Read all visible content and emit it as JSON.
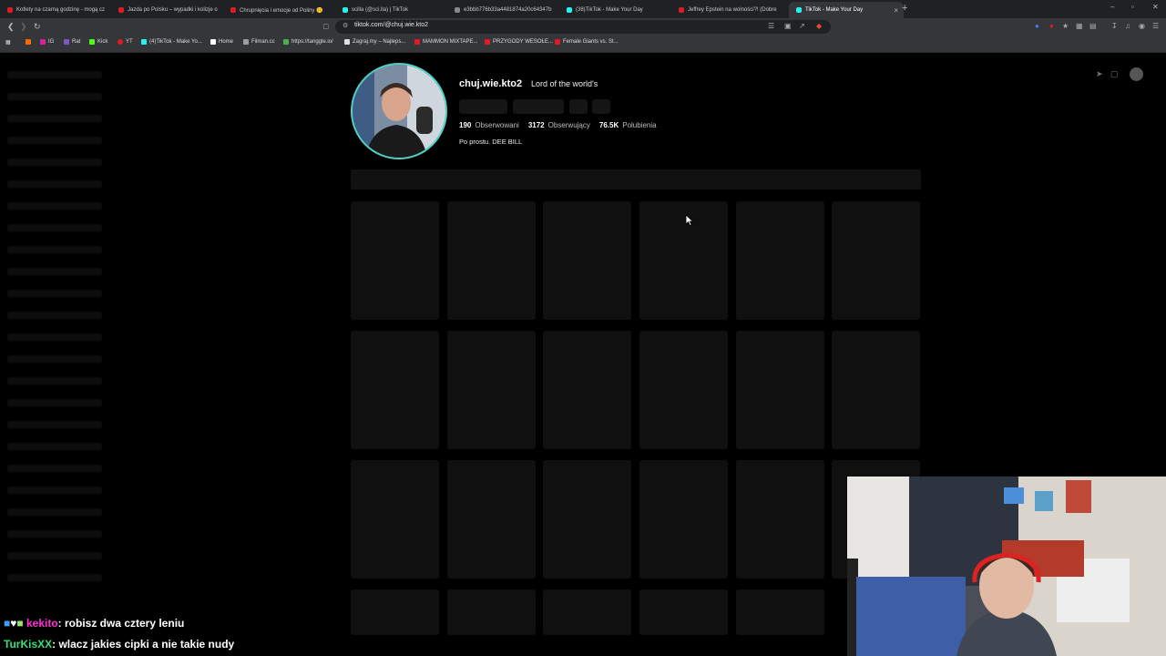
{
  "browser": {
    "tabs": [
      {
        "title": "Kotlety na czarną godzinę - mogą cz",
        "fav_color": "#e01b24"
      },
      {
        "title": "Jazda po Polsku – wypadki i kolizje o",
        "fav_color": "#e01b24"
      },
      {
        "title": "Chrupnięcia i emocje od Poliny 🤫",
        "fav_color": "#e01b24"
      },
      {
        "title": "scilla (@sci.lla) | TikTok",
        "fav_color": "#25f4ee"
      },
      {
        "title": "e3bbb776b33a4481874a20c64347b",
        "fav_color": "#888888"
      },
      {
        "title": "(38)TikTok - Make Your Day",
        "fav_color": "#25f4ee"
      },
      {
        "title": "Jeffrey Epstein na wolności?! (Dobre",
        "fav_color": "#e01b24"
      },
      {
        "title": "TikTok - Make Your Day",
        "fav_color": "#25f4ee",
        "active": true
      }
    ],
    "new_tab": "+",
    "close_tab": "×",
    "window_controls": [
      "–",
      "▫",
      "✕"
    ],
    "url": "tiktok.com/@chuj.wie.kto2",
    "bookmarks": [
      {
        "label": "",
        "color": "#ff6a00"
      },
      {
        "label": "IG",
        "color": "#d6249f"
      },
      {
        "label": "Rat",
        "color": "#7e57c2"
      },
      {
        "label": "Kick",
        "color": "#53fc18"
      },
      {
        "label": "YT",
        "color": "#e01b24"
      },
      {
        "label": "(4)TikTok - Make Yo...",
        "color": "#25f4ee"
      },
      {
        "label": "Home",
        "color": "#ffffff"
      },
      {
        "label": "Filman.cc",
        "color": "#9e9e9e"
      },
      {
        "label": "https://tanggle.io/",
        "color": "#4caf50"
      },
      {
        "label": "Zagraj.my – Najleps...",
        "color": "#e0e0e0"
      },
      {
        "label": "MAMMON MIXTAPE...",
        "color": "#e01b24"
      },
      {
        "label": "PRZYGODY WESOŁE...",
        "color": "#e01b24"
      },
      {
        "label": "Female Giants vs. St...",
        "color": "#e01b24"
      }
    ]
  },
  "profile": {
    "username": "chuj.wie.kto2",
    "nickname": "Lord of the world's",
    "stats": [
      {
        "value": "190",
        "label": "Obserwowani"
      },
      {
        "value": "3172",
        "label": "Obserwujący"
      },
      {
        "value": "76.5K",
        "label": "Polubienia"
      }
    ],
    "bio": "Po prostu. DEE BILL",
    "accent_color": "#4fd1c5"
  },
  "chat": [
    {
      "user": "kekito",
      "message": ": robisz dwa cztery leniu"
    },
    {
      "user": "TurKisXX",
      "message": ": wlacz jakies cipki a nie takie nudy"
    }
  ]
}
